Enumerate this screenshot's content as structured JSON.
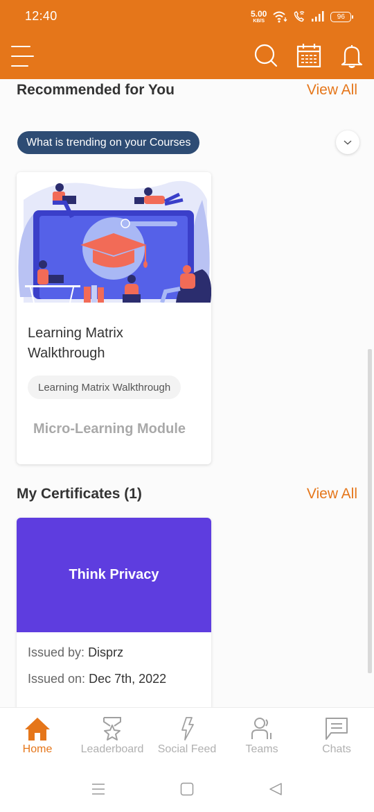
{
  "status_bar": {
    "time": "12:40",
    "net_speed_value": "5.00",
    "net_speed_unit": "KB/S",
    "battery": "96"
  },
  "header": {
    "icons": [
      "menu-icon",
      "search-icon",
      "calendar-icon",
      "bell-icon"
    ],
    "brand_color": "#e5761a"
  },
  "recommended": {
    "title": "Recommended for You",
    "view_all": "View All",
    "filter_pill": "What is trending on your Courses",
    "course": {
      "title": "Learning Matrix Walkthrough",
      "tag": "Learning Matrix Walkthrough",
      "type": "Micro-Learning Module"
    }
  },
  "certificates": {
    "title": "My Certificates (1)",
    "view_all": "View All",
    "items": [
      {
        "name": "Think Privacy",
        "issued_by_label": "Issued by:",
        "issued_by": "Disprz",
        "issued_on_label": "Issued on:",
        "issued_on": "Dec 7th, 2022",
        "banner_color": "#5e3ddf"
      }
    ]
  },
  "bottom_nav": {
    "items": [
      {
        "label": "Home",
        "icon": "home-icon",
        "active": true
      },
      {
        "label": "Leaderboard",
        "icon": "medal-icon",
        "active": false
      },
      {
        "label": "Social Feed",
        "icon": "lightning-icon",
        "active": false
      },
      {
        "label": "Teams",
        "icon": "team-icon",
        "active": false
      },
      {
        "label": "Chats",
        "icon": "chat-icon",
        "active": false
      }
    ]
  },
  "system_nav": {
    "icons": [
      "recent-apps-icon",
      "home-button-icon",
      "back-icon"
    ]
  }
}
